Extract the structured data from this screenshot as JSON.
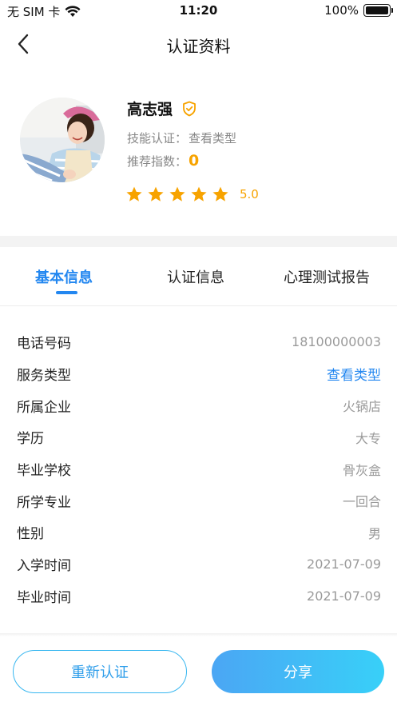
{
  "status_bar": {
    "carrier": "无 SIM 卡",
    "time": "11:20",
    "battery": "100%"
  },
  "nav": {
    "title": "认证资料"
  },
  "profile": {
    "name": "高志强",
    "skill_label": "技能认证：",
    "skill_value": "查看类型",
    "recommend_label": "推荐指数：",
    "recommend_value": "0",
    "rating": "5.0",
    "stars": 5
  },
  "tabs": [
    {
      "label": "基本信息"
    },
    {
      "label": "认证信息"
    },
    {
      "label": "心理测试报告"
    }
  ],
  "info_rows": [
    {
      "label": "电话号码",
      "value": "18100000003"
    },
    {
      "label": "服务类型",
      "value": "查看类型"
    },
    {
      "label": "所属企业",
      "value": "火锅店"
    },
    {
      "label": "学历",
      "value": "大专"
    },
    {
      "label": "毕业学校",
      "value": "骨灰盒"
    },
    {
      "label": "所学专业",
      "value": "一回合"
    },
    {
      "label": "性别",
      "value": "男"
    },
    {
      "label": "入学时间",
      "value": "2021-07-09"
    },
    {
      "label": "毕业时间",
      "value": "2021-07-09"
    }
  ],
  "buttons": {
    "recert": "重新认证",
    "share": "分享"
  },
  "colors": {
    "accent": "#2387f0",
    "star": "#f7a300",
    "share_gradient_start": "#4ba6f4",
    "share_gradient_end": "#38d0f8"
  }
}
